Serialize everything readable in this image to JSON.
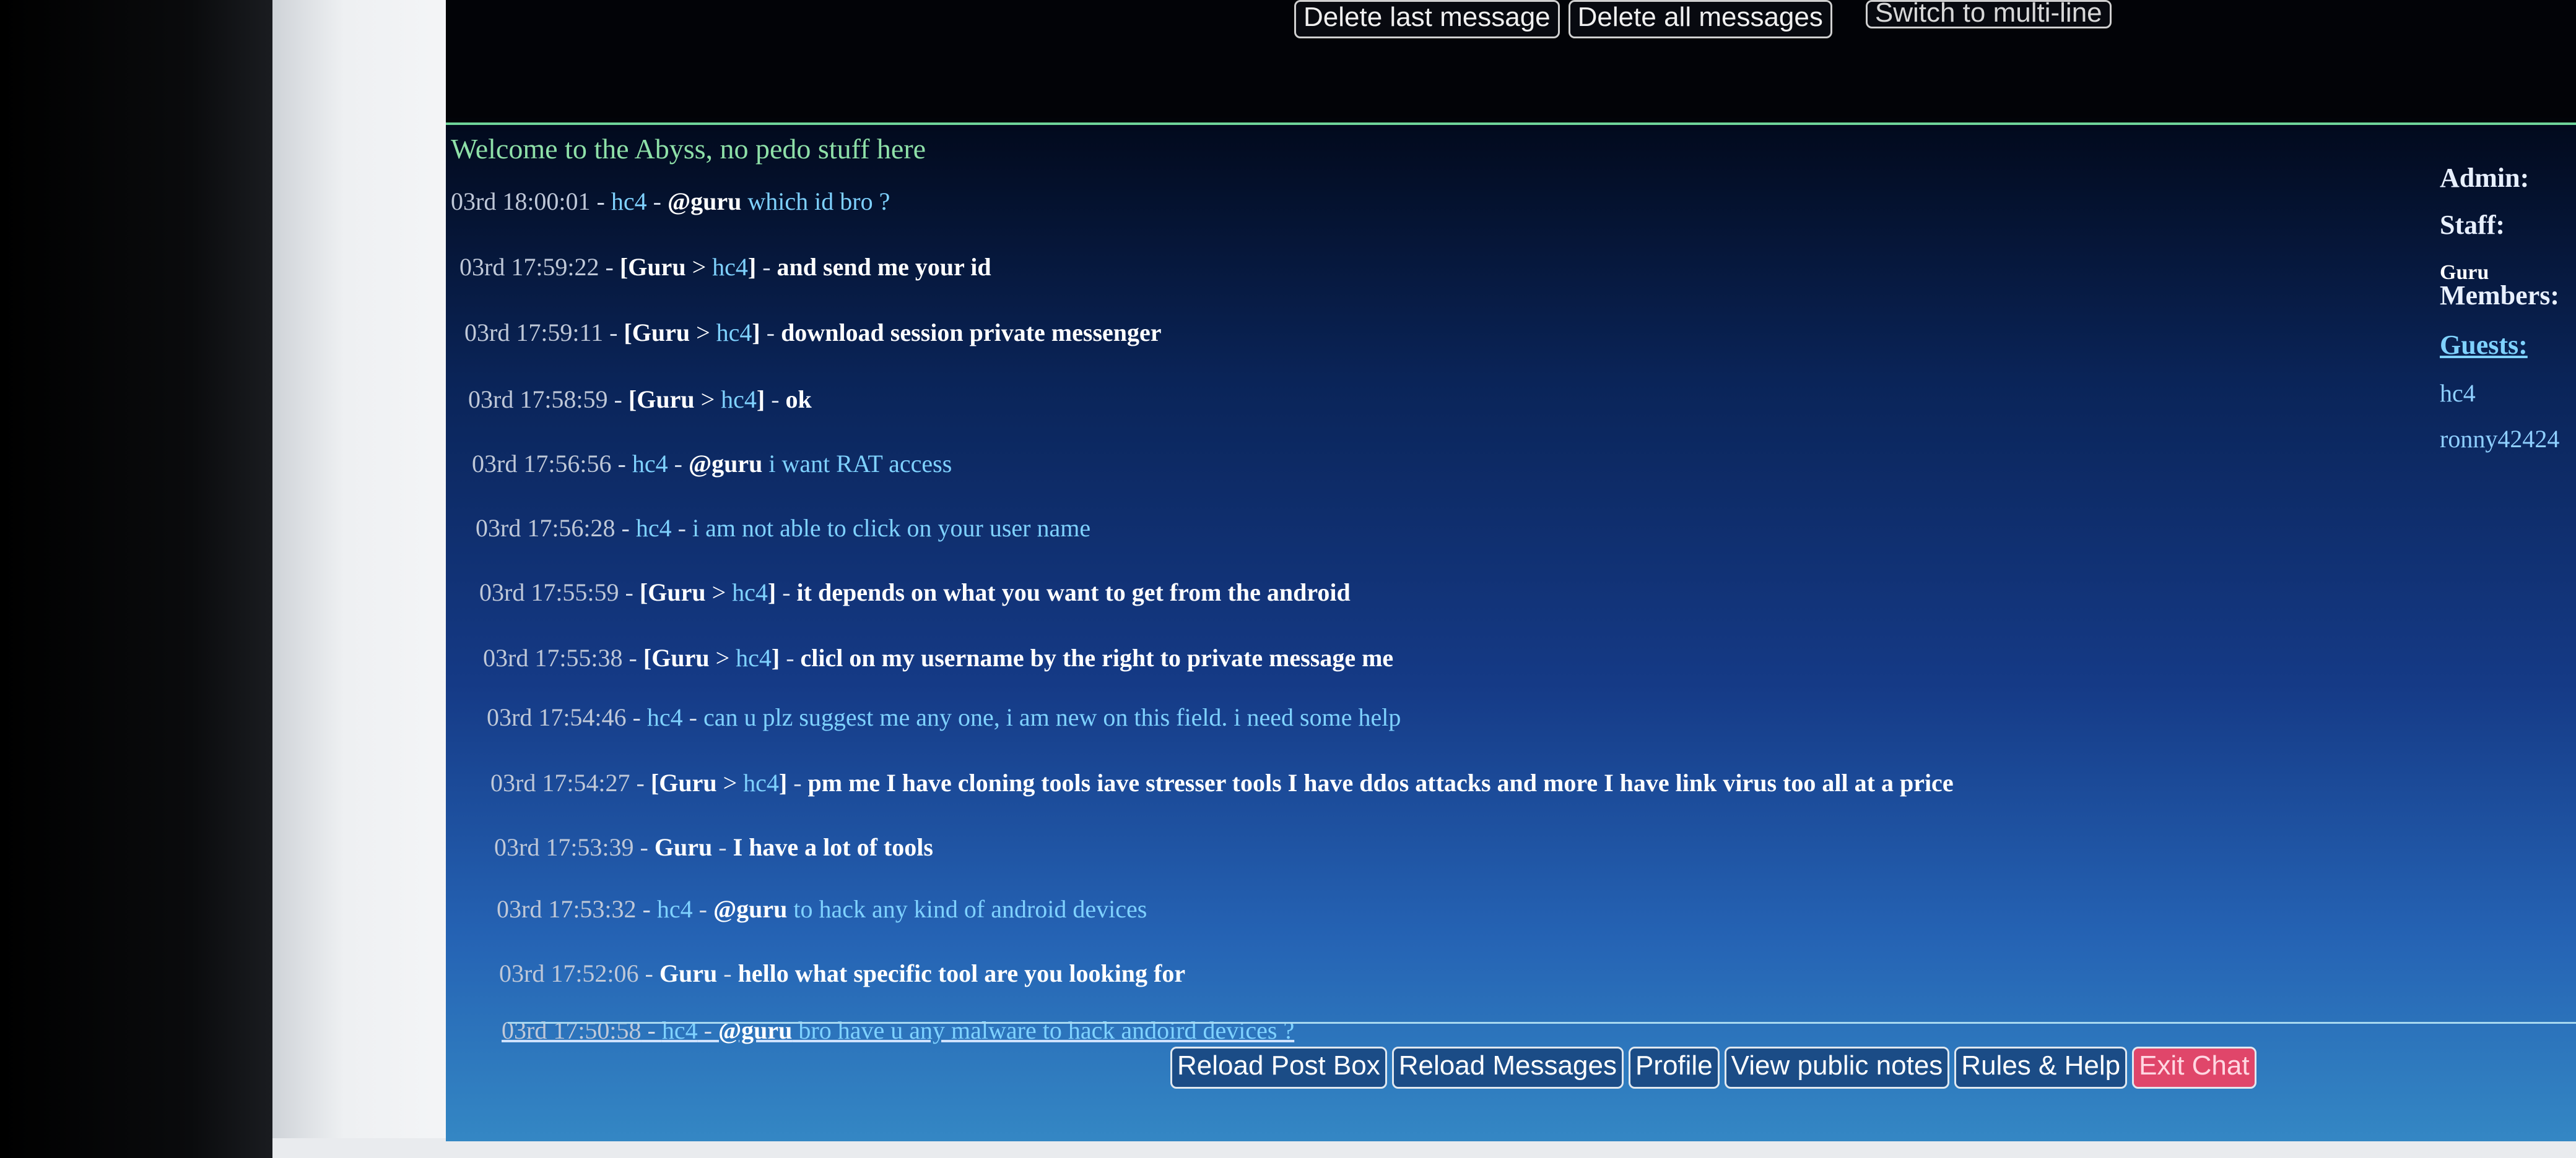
{
  "top_controls": {
    "delete_last": "Delete last message",
    "delete_all": "Delete all messages",
    "switch_multiline": "Switch to multi-line"
  },
  "chat": {
    "welcome": "Welcome to the Abyss, no pedo stuff here",
    "messages": [
      {
        "date": "03rd 18:00:01",
        "sep": " - ",
        "nick": "hc4",
        "dash": " - ",
        "bold": "@guru",
        "text": " which id bro ?"
      },
      {
        "date": "03rd 17:59:22",
        "sep": " - ",
        "open": "[",
        "from": "Guru",
        "arrow": " > ",
        "to": "hc4",
        "close": "]",
        "dash": " - ",
        "text": "and send me your id"
      },
      {
        "date": "03rd 17:59:11",
        "sep": " - ",
        "open": "[",
        "from": "Guru",
        "arrow": " > ",
        "to": "hc4",
        "close": "]",
        "dash": " - ",
        "text": "download session private messenger"
      },
      {
        "date": "03rd 17:58:59",
        "sep": " - ",
        "open": "[",
        "from": "Guru",
        "arrow": " > ",
        "to": "hc4",
        "close": "]",
        "dash": " - ",
        "text": "ok"
      },
      {
        "date": "03rd 17:56:56",
        "sep": " - ",
        "nick": "hc4",
        "dash": " - ",
        "bold": "@guru",
        "text": " i want RAT access"
      },
      {
        "date": "03rd 17:56:28",
        "sep": " - ",
        "nick": "hc4",
        "dash": " - ",
        "text": "i am not able to click on your user name"
      },
      {
        "date": "03rd 17:55:59",
        "sep": " - ",
        "open": "[",
        "from": "Guru",
        "arrow": " > ",
        "to": "hc4",
        "close": "]",
        "dash": " - ",
        "text": "it depends on what you want to get from the android"
      },
      {
        "date": "03rd 17:55:38",
        "sep": " - ",
        "open": "[",
        "from": "Guru",
        "arrow": " > ",
        "to": "hc4",
        "close": "]",
        "dash": " - ",
        "text": "clicl on my username by the right to private message me"
      },
      {
        "date": "03rd 17:54:46",
        "sep": " - ",
        "nick": "hc4",
        "dash": " - ",
        "text": "can u plz suggest me any one, i am new on this field. i need some help"
      },
      {
        "date": "03rd 17:54:27",
        "sep": " - ",
        "open": "[",
        "from": "Guru",
        "arrow": " > ",
        "to": "hc4",
        "close": "]",
        "dash": " - ",
        "text": "pm me I have cloning tools iave stresser tools I have ddos attacks and more I have link virus too all at a price"
      },
      {
        "date": "03rd 17:53:39",
        "sep": " - ",
        "gurunick": "Guru",
        "dash": " - ",
        "text": "I have a lot of tools"
      },
      {
        "date": "03rd 17:53:32",
        "sep": " - ",
        "nick": "hc4",
        "dash": " - ",
        "bold": "@guru",
        "text": " to hack any kind of android devices"
      },
      {
        "date": "03rd 17:52:06",
        "sep": " - ",
        "gurunick": "Guru",
        "dash": " - ",
        "text": "hello what specific tool are you looking for"
      },
      {
        "date": "03rd 17:50:58",
        "sep": " - ",
        "nick": "hc4",
        "dash": " - ",
        "bold": "@guru",
        "text": " bro have u any malware to hack andoird devices ?"
      }
    ]
  },
  "sidebar": {
    "admin_label": "Admin:",
    "staff_label": "Staff:",
    "staff_user": "Guru",
    "members_label": "Members:",
    "guests_label": "Guests:",
    "guests": [
      "hc4",
      "ronny42424"
    ]
  },
  "bottom_controls": {
    "reload_post": "Reload Post Box",
    "reload_messages": "Reload Messages",
    "profile": "Profile",
    "public_notes": "View public notes",
    "rules": "Rules & Help",
    "exit": "Exit Chat"
  },
  "colors": {
    "welcome": "#8ee0a8",
    "nick": "#7fd2ff",
    "exit_button": "#e0466a"
  }
}
